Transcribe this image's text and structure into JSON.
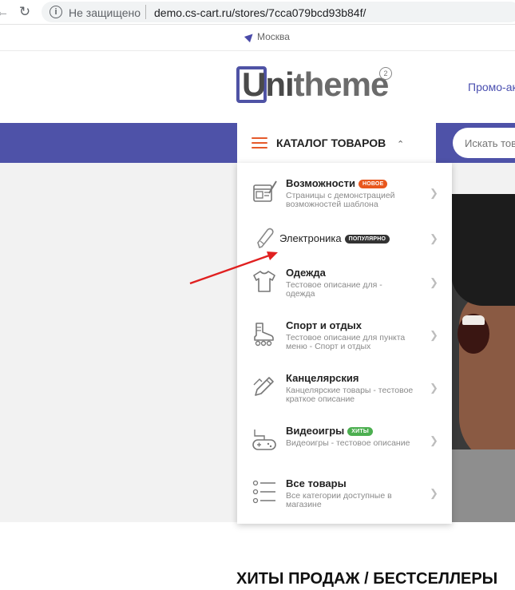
{
  "browser": {
    "security_label": "Не защищено",
    "url": "demo.cs-cart.ru/stores/7cca079bcd93b84f/"
  },
  "header": {
    "location": "Москва",
    "logo": "Unitheme",
    "logo_badge": "2",
    "promo_link": "Промо-акц"
  },
  "navbar": {
    "catalog_label": "КАТАЛОГ ТОВАРОВ",
    "search_placeholder": "Искать тов"
  },
  "catalog_menu": {
    "items": [
      {
        "title": "Возможности",
        "badge": "НОВОЕ",
        "badge_color": "#e8571d",
        "description": "Страницы с демонстрацией возможностей шаблона",
        "icon": "layout-icon"
      },
      {
        "title": "Электроника",
        "badge": "ПОПУЛЯРНО",
        "badge_color": "#333333",
        "description": "",
        "icon": "pen-icon"
      },
      {
        "title": "Одежда",
        "badge": "",
        "description": "Тестовое описание для - одежда",
        "icon": "tshirt-icon"
      },
      {
        "title": "Спорт и отдых",
        "badge": "",
        "description": "Тестовое описание для пункта меню - Спорт и отдых",
        "icon": "rollerskate-icon"
      },
      {
        "title": "Канцелярския",
        "badge": "",
        "description": "Канцелярские товары - тестовое краткое описание",
        "icon": "pencil-icon"
      },
      {
        "title": "Видеоигры",
        "badge": "ХИТЫ",
        "badge_color": "#4caf50",
        "description": "Видеоигры - тестовое описание",
        "icon": "gamepad-icon"
      },
      {
        "title": "Все товары",
        "badge": "",
        "description": "Все категории доступные в магазине",
        "icon": "list-icon"
      }
    ]
  },
  "section_title": "ХИТЫ ПРОДАЖ / БЕСТСЕЛЛЕРЫ",
  "colors": {
    "brand": "#4e52a8",
    "accent": "#e55a2b",
    "annotation_arrow": "#e02020"
  }
}
